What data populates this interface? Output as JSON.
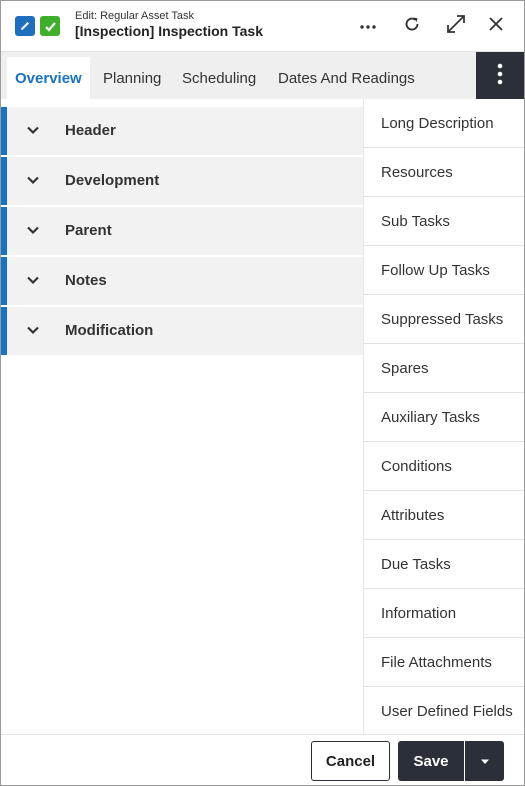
{
  "titlebar": {
    "subtitle": "Edit: Regular Asset Task",
    "title": "[Inspection] Inspection Task",
    "icons": [
      "pencil-icon",
      "check-icon",
      "more-horizontal-icon",
      "refresh-icon",
      "expand-icon",
      "close-icon"
    ]
  },
  "tabs": [
    {
      "label": "Overview",
      "active": true
    },
    {
      "label": "Planning",
      "active": false
    },
    {
      "label": "Scheduling",
      "active": false
    },
    {
      "label": "Dates And Readings",
      "active": false
    }
  ],
  "sections": [
    {
      "label": "Header"
    },
    {
      "label": "Development"
    },
    {
      "label": "Parent"
    },
    {
      "label": "Notes"
    },
    {
      "label": "Modification"
    }
  ],
  "side_menu": [
    {
      "label": "Long Description"
    },
    {
      "label": "Resources"
    },
    {
      "label": "Sub Tasks"
    },
    {
      "label": "Follow Up Tasks"
    },
    {
      "label": "Suppressed Tasks"
    },
    {
      "label": "Spares"
    },
    {
      "label": "Auxiliary Tasks"
    },
    {
      "label": "Conditions"
    },
    {
      "label": "Attributes"
    },
    {
      "label": "Due Tasks"
    },
    {
      "label": "Information"
    },
    {
      "label": "File Attachments"
    },
    {
      "label": "User Defined Fields"
    }
  ],
  "footer": {
    "cancel_label": "Cancel",
    "save_label": "Save"
  },
  "colors": {
    "accent": "#1a73c1",
    "dark": "#2b2f38",
    "check_green": "#3fae2a"
  }
}
